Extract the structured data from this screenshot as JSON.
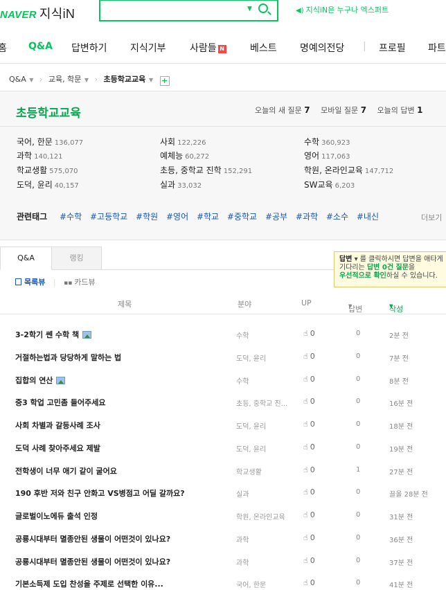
{
  "header": {
    "logo_brand": "NAVER",
    "logo_service": "지식iN",
    "search_placeholder": "",
    "promo_text": "지식iN은 누구나 엑스퍼트"
  },
  "nav": {
    "items": [
      {
        "label": "홈"
      },
      {
        "label": "Q&A",
        "active": true
      },
      {
        "label": "답변하기"
      },
      {
        "label": "지식기부"
      },
      {
        "label": "사람들",
        "badge": "N"
      },
      {
        "label": "베스트"
      },
      {
        "label": "명예의전당"
      },
      {
        "label": "프로필"
      },
      {
        "label": "파트"
      }
    ],
    "separator": "|"
  },
  "breadcrumb": {
    "root": "Q&A",
    "level1": "교육, 학문",
    "current": "초등학교교육",
    "add": "+"
  },
  "category": {
    "title": "초등학교교육",
    "stats": [
      {
        "label": "오늘의 새 질문",
        "value": "7"
      },
      {
        "label": "모바일 질문",
        "value": "7"
      },
      {
        "label": "오늘의 답변",
        "value": "1"
      }
    ],
    "subcategories": [
      {
        "name": "국어, 한문",
        "count": "136,077"
      },
      {
        "name": "사회",
        "count": "122,226"
      },
      {
        "name": "수학",
        "count": "360,923"
      },
      {
        "name": "과학",
        "count": "140,121"
      },
      {
        "name": "예체능",
        "count": "60,272"
      },
      {
        "name": "영어",
        "count": "117,063"
      },
      {
        "name": "학교생활",
        "count": "575,070"
      },
      {
        "name": "초등, 중학교 진학",
        "count": "152,291"
      },
      {
        "name": "학원, 온라인교육",
        "count": "147,712"
      },
      {
        "name": "도덕, 윤리",
        "count": "40,157"
      },
      {
        "name": "실과",
        "count": "33,032"
      },
      {
        "name": "SW교육",
        "count": "6,203"
      }
    ],
    "tags_label": "관련태그",
    "tags": [
      "#수학",
      "#고등학교",
      "#학원",
      "#영어",
      "#학교",
      "#중학교",
      "#공부",
      "#과학",
      "#소수",
      "#내신"
    ],
    "more": "더보기"
  },
  "tabs": [
    {
      "label": "Q&A",
      "active": true
    },
    {
      "label": "랭킹",
      "active": false
    }
  ],
  "tooltip": {
    "line1_a": "답변",
    "line1_b": "를 클릭하시면 답변을 애타게",
    "line2_a": "기다리는 ",
    "line2_b": "답변 0건 질문",
    "line2_c": "을",
    "line3_a": "우선적으로 확인",
    "line3_b": "하실 수 있습니다."
  },
  "view_toggle": {
    "list": "목록뷰",
    "card": "카드뷰"
  },
  "table": {
    "headers": {
      "title": "제목",
      "field": "분야",
      "up": "UP",
      "answers": "답변",
      "written": "작성"
    },
    "rows": [
      {
        "title": "3-2학기 쎈 수학 책",
        "image": true,
        "field": "수학",
        "up": "0",
        "answers": "0",
        "time": "2분 전"
      },
      {
        "title": "거절하는법과 당당하게 말하는 법",
        "image": false,
        "field": "도덕, 윤리",
        "up": "0",
        "answers": "0",
        "time": "7분 전"
      },
      {
        "title": "집합의 연산",
        "image": true,
        "field": "수학",
        "up": "0",
        "answers": "0",
        "time": "8분 전"
      },
      {
        "title": "중3 학업 고민좀 들어주세요",
        "image": false,
        "field": "초등, 중학교 진...",
        "up": "0",
        "answers": "0",
        "time": "16분 전"
      },
      {
        "title": "사회 차별과 갈등사례 조사",
        "image": false,
        "field": "도덕, 윤리",
        "up": "0",
        "answers": "0",
        "time": "18분 전"
      },
      {
        "title": "도덕 사례 찾아주세요 제발",
        "image": false,
        "field": "도덕, 윤리",
        "up": "0",
        "answers": "0",
        "time": "19분 전"
      },
      {
        "title": "전학생이 너무 애기 같이 굴어요",
        "image": false,
        "field": "학교생활",
        "up": "0",
        "answers": "1",
        "time": "27분 전"
      },
      {
        "title": "190 후반 저와 친구 안화고 VS병점고 어딜 갈까요?",
        "image": false,
        "field": "실과",
        "up": "0",
        "answers": "0",
        "time": "끌올 28분 전"
      },
      {
        "title": "글로벌이노에듀 출석 인정",
        "image": false,
        "field": "학원, 온라인교육",
        "up": "0",
        "answers": "0",
        "time": "31분 전"
      },
      {
        "title": "공룡시대부터 멸종안된 생물이 어떤것이 있나요?",
        "image": false,
        "field": "과학",
        "up": "0",
        "answers": "0",
        "time": "36분 전"
      },
      {
        "title": "공룡시대부터 멸종안된 생물이 어떤것이 있나요?",
        "image": false,
        "field": "과학",
        "up": "0",
        "answers": "0",
        "time": "37분 전"
      },
      {
        "title": "기본소득제 도입 찬성을 주제로 선택한 이유...",
        "image": false,
        "field": "국어, 한문",
        "up": "0",
        "answers": "0",
        "time": "41분 전"
      }
    ]
  },
  "colors": {
    "brand_green": "#03c75a",
    "tag_blue": "#1a56b8"
  },
  "icons": {
    "search": "search-icon",
    "speaker": "speaker-icon",
    "thumb": "thumbs-up-icon",
    "image": "image-attachment-icon"
  }
}
